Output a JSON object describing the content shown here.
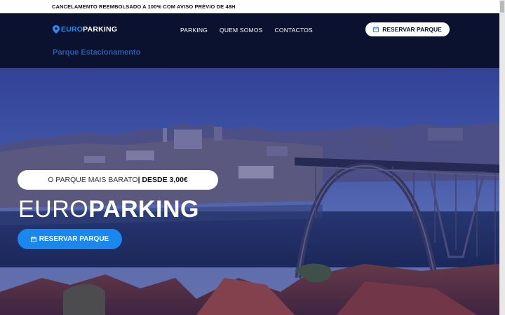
{
  "topbar": {
    "notice": "CANCELAMENTO REEMBOLSADO A 100% COM AVISO PRÉVIO DE 48H"
  },
  "header": {
    "logo_euro": "EURO",
    "logo_parking": "PARKING",
    "nav": [
      {
        "label": "PARKING"
      },
      {
        "label": "QUEM SOMOS"
      },
      {
        "label": "CONTACTOS"
      }
    ],
    "reserve_label": "RESERVAR PARQUE",
    "breadcrumb": "Parque Estacionamento"
  },
  "hero": {
    "tagline_normal": "O PARQUE MAIS BARATO",
    "tagline_bold": " | DESDE 3,00€",
    "title_thin": "EURO",
    "title_bold": "PARKING",
    "button_label": "RESERVAR PARQUE"
  },
  "colors": {
    "brand_blue": "#2f88f0",
    "header_bg": "#0b1230",
    "button_blue": "#1a87ee"
  },
  "icons": {
    "logo": "map-pin-icon",
    "reserve": "calendar-icon"
  }
}
